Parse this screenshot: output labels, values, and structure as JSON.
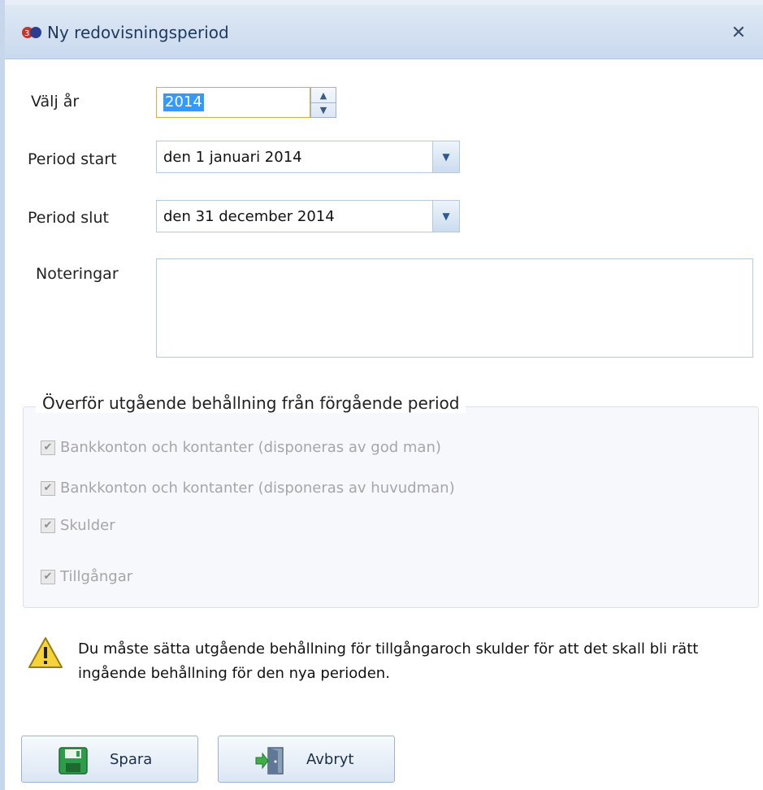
{
  "window": {
    "title": "Ny redovisningsperiod",
    "close_symbol": "✕"
  },
  "form": {
    "year_label": "Välj år",
    "year_value": "2014",
    "period_start_label": "Period start",
    "period_start_value": "den 1 januari 2014",
    "period_end_label": "Period slut",
    "period_end_value": "den 31 december 2014",
    "notes_label": "Noteringar",
    "notes_value": ""
  },
  "transfer_group": {
    "title": "Överför utgående behållning från förgående period",
    "items": [
      {
        "label": "Bankkonton och kontanter (disponeras av god man)",
        "checked": true,
        "enabled": false
      },
      {
        "label": "Bankkonton och kontanter (disponeras av huvudman)",
        "checked": true,
        "enabled": false
      },
      {
        "label": "Skulder",
        "checked": true,
        "enabled": false
      },
      {
        "label": "Tillgångar",
        "checked": true,
        "enabled": false
      }
    ]
  },
  "warning": {
    "text": "Du måste sätta utgående behållning för tillgångaroch skulder för att det skall bli rätt ingående behållning för den nya perioden.",
    "icon": "warning-icon"
  },
  "buttons": {
    "save_label": "Spara",
    "cancel_label": "Avbryt"
  },
  "colors": {
    "title_text": "#1e395b",
    "selection": "#3399ff",
    "focus_border": "#e8a83a",
    "disabled_text": "#a6a6a6"
  }
}
